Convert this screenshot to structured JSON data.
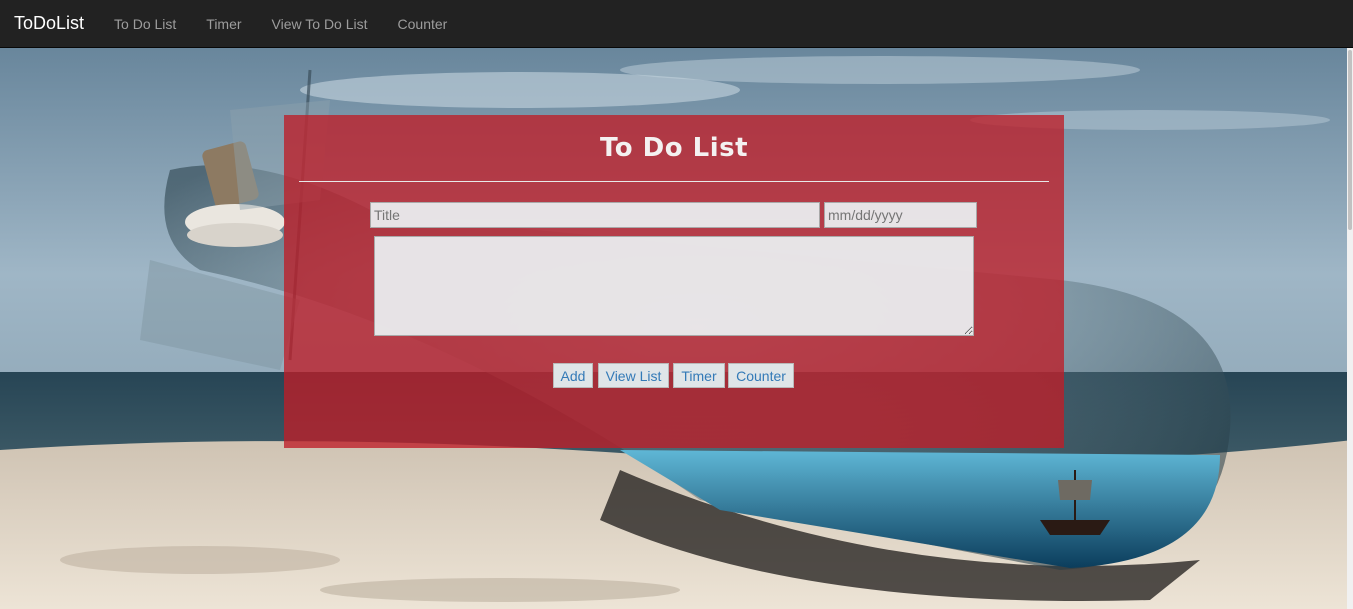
{
  "navbar": {
    "brand": "ToDoList",
    "links": [
      "To Do List",
      "Timer",
      "View To Do List",
      "Counter"
    ]
  },
  "panel": {
    "title": "To Do List",
    "title_placeholder": "Title",
    "date_placeholder": "mm/dd/yyyy",
    "buttons": {
      "add": "Add",
      "view_list": "View List",
      "timer": "Timer",
      "counter": "Counter"
    }
  },
  "colors": {
    "navbar_bg": "#222222",
    "brand": "#ffffff",
    "nav_link": "#9d9d9d",
    "panel_bg": "rgba(190,30,40,0.78)",
    "button_text": "#337ab7"
  }
}
